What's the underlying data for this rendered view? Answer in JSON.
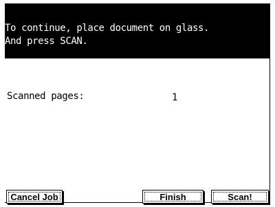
{
  "header": {
    "line1": "To continue, place document on glass.",
    "line2": "And press SCAN."
  },
  "status": {
    "scanned_label": "Scanned pages:",
    "scanned_count": "1"
  },
  "buttons": {
    "cancel": "Cancel Job",
    "finish": "Finish",
    "scan": "Scan!"
  },
  "colors": {
    "header_bg": "#000000",
    "header_text": "#ffffff",
    "body_bg": "#ffffff"
  }
}
